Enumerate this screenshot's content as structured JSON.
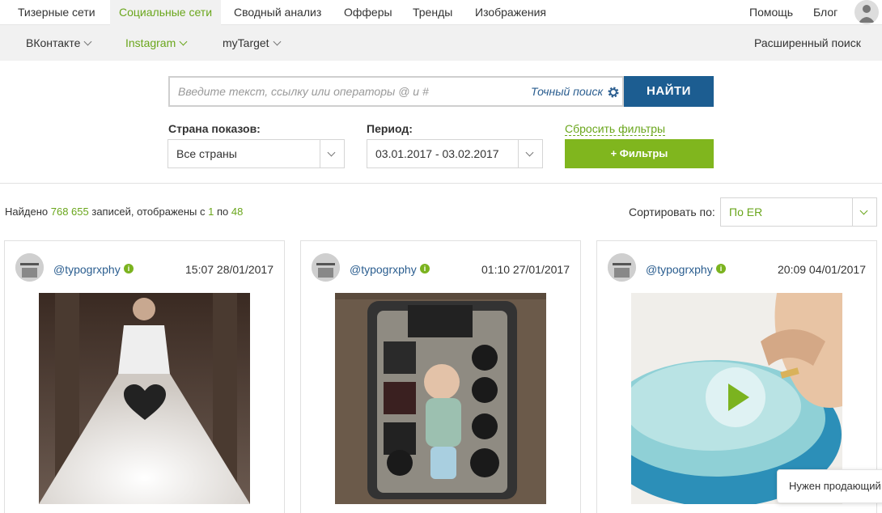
{
  "topnav": {
    "items": [
      {
        "label": "Тизерные сети"
      },
      {
        "label": "Социальные сети"
      },
      {
        "label": "Сводный анализ"
      },
      {
        "label": "Офферы"
      },
      {
        "label": "Тренды"
      },
      {
        "label": "Изображения"
      }
    ],
    "help": "Помощь",
    "blog": "Блог"
  },
  "subnav": {
    "items": [
      {
        "label": "ВКонтакте"
      },
      {
        "label": "Instagram"
      },
      {
        "label": "myTarget"
      }
    ],
    "advanced": "Расширенный поиск"
  },
  "search": {
    "placeholder": "Введите текст, ссылку или операторы @ и #",
    "exact": "Точный поиск",
    "button": "НАЙТИ"
  },
  "filters": {
    "country_label": "Страна показов:",
    "country_value": "Все страны",
    "period_label": "Период:",
    "period_value": "03.01.2017 - 03.02.2017",
    "reset": "Сбросить фильтры",
    "filters_button": "+ Фильтры"
  },
  "results": {
    "prefix": "Найдено",
    "total": "768 655",
    "middle": "записей, отображены с",
    "from": "1",
    "to_word": "по",
    "to": "48"
  },
  "sort": {
    "label": "Сортировать по:",
    "value": "По ER"
  },
  "cards": [
    {
      "user": "@typogrxphy",
      "time": "15:07 28/01/2017",
      "media_type": "image"
    },
    {
      "user": "@typogrxphy",
      "time": "01:10 27/01/2017",
      "media_type": "image"
    },
    {
      "user": "@typogrxphy",
      "time": "20:09 04/01/2017",
      "media_type": "video"
    }
  ],
  "toast": "Нужен продающий л",
  "colors": {
    "accent_green": "#80b61e",
    "link_blue": "#2a5d8f",
    "button_blue": "#1c5d91"
  }
}
